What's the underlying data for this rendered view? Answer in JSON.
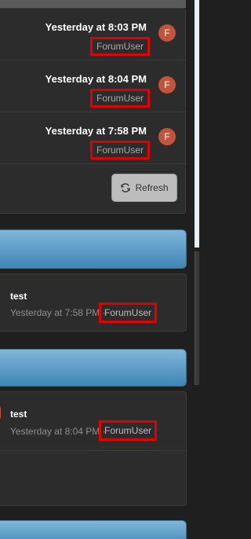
{
  "recent_activity": {
    "items": [
      {
        "time": "Yesterday at 8:03 PM",
        "user": "ForumUser",
        "avatar_letter": "F"
      },
      {
        "time": "Yesterday at 8:04 PM",
        "user": "ForumUser",
        "avatar_letter": "F"
      },
      {
        "time": "Yesterday at 7:58 PM",
        "user": "ForumUser",
        "avatar_letter": "F"
      }
    ],
    "refresh_label": "Refresh",
    "refresh_icon": "refresh-icon"
  },
  "posts": [
    {
      "title": "test",
      "meta": "Yesterday at 7:58 PM ·",
      "user": "ForumUser"
    },
    {
      "title": "test",
      "meta": "Yesterday at 8:04 PM ·",
      "user": "ForumUser"
    }
  ],
  "colors": {
    "highlight": "#e10000",
    "avatar": "#c0553b",
    "header": "#4f93c0"
  }
}
